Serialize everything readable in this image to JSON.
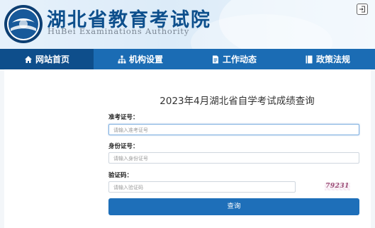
{
  "header": {
    "title_cn": "湖北省教育考试院",
    "title_en": "HuBei Examinations Authority",
    "logo_icon": "hubei-exam-authority-seal-icon",
    "exit_icon": "exit-icon"
  },
  "nav": {
    "items": [
      {
        "label": "网站首页",
        "icon": "home-icon",
        "active": true
      },
      {
        "label": "机构设置",
        "icon": "org-chart-icon",
        "active": false
      },
      {
        "label": "工作动态",
        "icon": "document-icon",
        "active": false
      },
      {
        "label": "政策法规",
        "icon": "book-icon",
        "active": false
      }
    ]
  },
  "form": {
    "title": "2023年4月湖北省自学考试成绩查询",
    "fields": [
      {
        "label": "准考证号：",
        "placeholder": "请输入准考证号"
      },
      {
        "label": "身份证号：",
        "placeholder": "请输入身份证号"
      },
      {
        "label": "验证码：",
        "placeholder": "请输入验证码"
      }
    ],
    "captcha_text": "79231",
    "submit_label": "查询"
  },
  "colors": {
    "nav_bg": "#1b6cb4",
    "nav_active": "#0e4e8b",
    "title_blue": "#0d4f8c",
    "button_bg": "#1e6fb9"
  }
}
